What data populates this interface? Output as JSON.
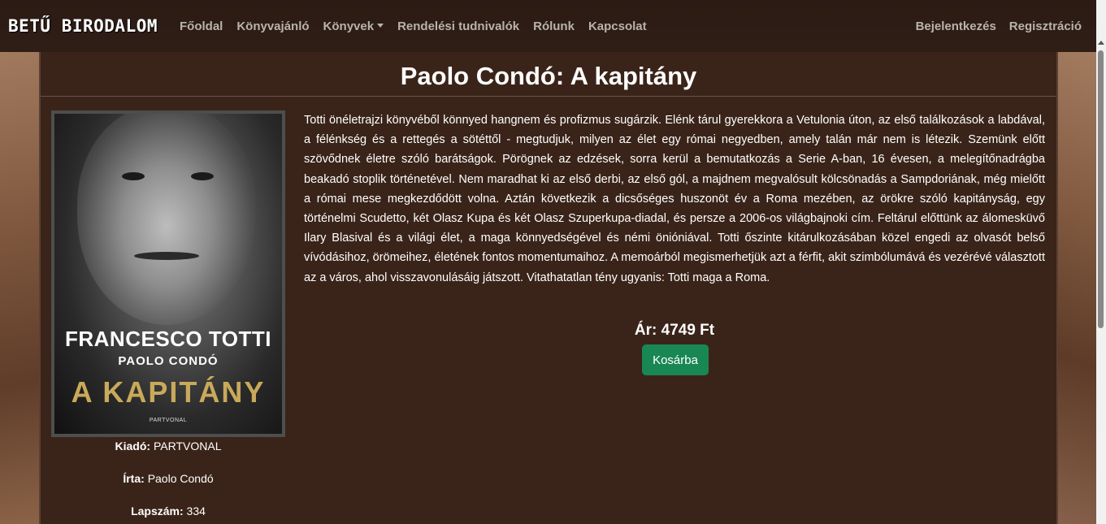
{
  "brand": "BETŰ BIRODALOM",
  "nav": {
    "left": [
      "Főoldal",
      "Könyvajánló",
      "Könyvek",
      "Rendelési tudnivalók",
      "Rólunk",
      "Kapcsolat"
    ],
    "right": [
      "Bejelentkezés",
      "Regisztráció"
    ]
  },
  "book": {
    "title": "Paolo Condó: A kapitány",
    "cover": {
      "author": "FRANCESCO TOTTI",
      "coauthor": "PAOLO CONDÓ",
      "title": "A KAPITÁNY",
      "publisher": "PARTVONAL"
    },
    "description": "Totti önéletrajzi könyvéből könnyed hangnem és profizmus sugárzik. Elénk tárul gyerekkora a Vetulonia úton, az első találkozások a labdával, a félénkség és a rettegés a sötéttől - megtudjuk, milyen az élet egy római negyedben, amely talán már nem is létezik. Szemünk előtt szövődnek életre szóló barátságok. Pörögnek az edzések, sorra kerül a bemutatkozás a Serie A-ban, 16 évesen, a melegítőnadrágba beakadó stoplik történetével. Nem maradhat ki az első derbi, az első gól, a majdnem megvalósult kölcsönadás a Sampdoriának, még mielőtt a római mese megkezdődött volna. Aztán következik a dicsőséges huszonöt év a Roma mezében, az örökre szóló kapitányság, egy történelmi Scudetto, két Olasz Kupa és két Olasz Szuperkupa-diadal, és persze a 2006-os világbajnoki cím. Feltárul előttünk az álomesküvő Ilary Blasival és a világi élet, a maga könnyedségével és némi önióniával. Totti őszinte kitárulkozásában közel engedi az olvasót belső vívódásihoz, örömeihez, életének fontos momentumaihoz. A memoárból megismerhetjük azt a férfit, akit szimbólumává és vezérévé választott az a város, ahol visszavonulásáig játszott. Vitathatatlan tény ugyanis: Totti maga a Roma.",
    "price_label": "Ár:",
    "price_value": "4749 Ft",
    "cart_label": "Kosárba",
    "meta": {
      "publisher_label": "Kiadó:",
      "publisher_value": "PARTVONAL",
      "author_label": "Írta:",
      "author_value": "Paolo Condó",
      "pages_label": "Lapszám:",
      "pages_value": "334"
    }
  }
}
